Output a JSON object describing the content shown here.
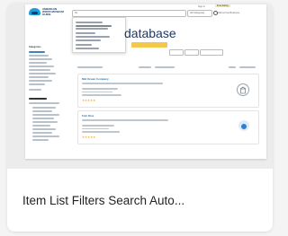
{
  "card": {
    "title": "Item List Filters Search Auto...",
    "preview": {
      "brand_name": "AMERICAN WOOD MUSEUM GUIDE",
      "top_links": {
        "sign_in": "Sign In",
        "free_listing": "Free listing"
      },
      "search_placeholder": "Se",
      "category_select": "All Categories",
      "header_right": "Add a Free Business",
      "page_heading": "database",
      "sidebar_heading": "Categories",
      "listings": [
        {
          "name": "Mid Ocean Company",
          "rating_stars": "★★★★★",
          "icon": "building-icon",
          "accent": "#9aa3ad"
        },
        {
          "name": "Fish Dive",
          "rating_stars": "★★★★★",
          "icon": "fish-icon",
          "accent": "#2f7fd0"
        }
      ]
    }
  },
  "colors": {
    "brand_dark": "#1a3a6b",
    "brand_light": "#1c9fd8",
    "accent_yellow": "#f2c94c",
    "link_blue": "#1a73b8"
  }
}
